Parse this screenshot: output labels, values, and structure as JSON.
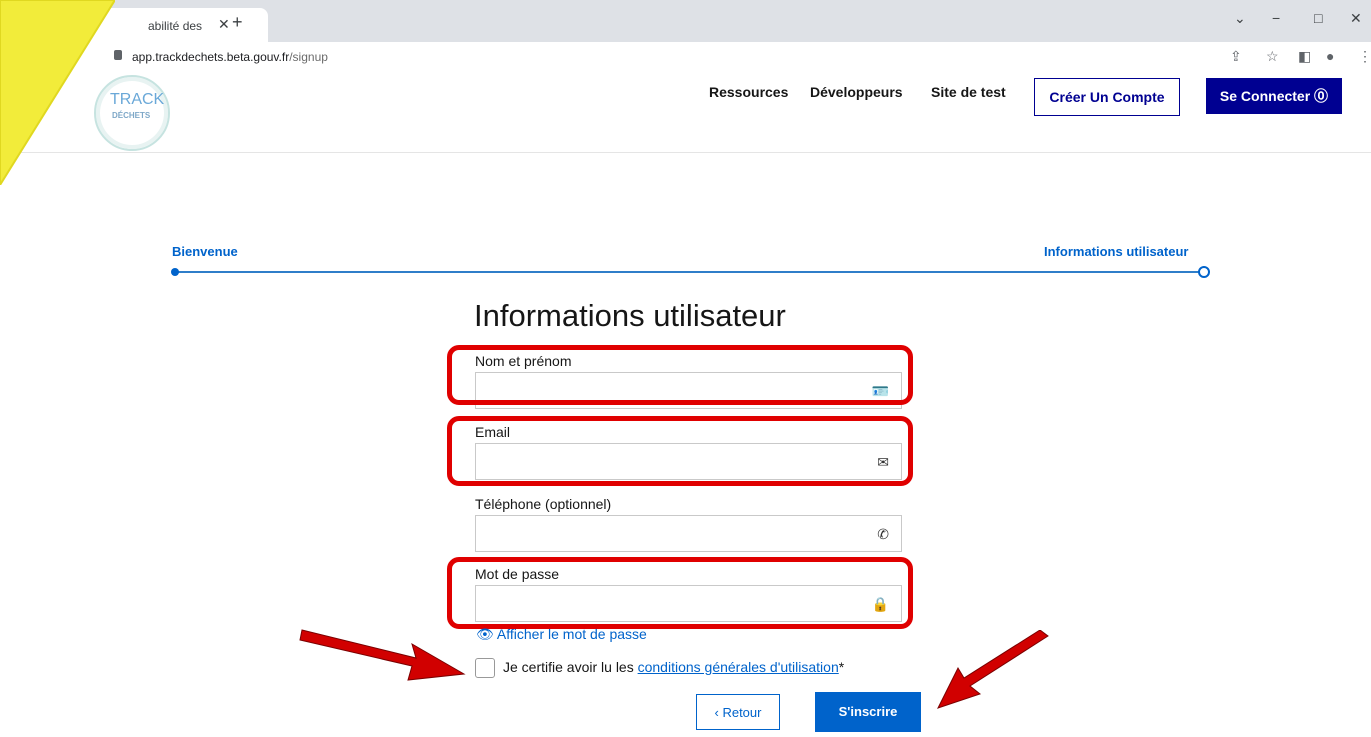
{
  "browser": {
    "tab_title": "abilité des",
    "tab_close": "✕",
    "new_tab": "+",
    "url_host": "app.trackdechets.beta.gouv.fr",
    "url_path": "/signup"
  },
  "site": {
    "logo_line1": "TRACK",
    "logo_line2": "DÉCHETS",
    "nav": [
      "Ressources",
      "Développeurs",
      "Site de test"
    ],
    "create_account": "Créer Un Compte",
    "login": "Se Connecter ⓪"
  },
  "stepper": {
    "step1": "Bienvenue",
    "step2": "Informations utilisateur"
  },
  "form": {
    "title": "Informations utilisateur",
    "fields": [
      {
        "label": "Nom et prénom",
        "icon": "id-card-icon"
      },
      {
        "label": "Email",
        "icon": "mail-icon"
      },
      {
        "label": "Téléphone (optionnel)",
        "icon": "phone-icon"
      },
      {
        "label": "Mot de passe",
        "icon": "lock-icon"
      }
    ],
    "show_password": "Afficher le mot de passe",
    "cgu_prefix": "Je certifie avoir lu les ",
    "cgu_link": "conditions générales d'utilisation",
    "cgu_suffix": "*",
    "back": "‹  Retour",
    "submit": "S'inscrire"
  },
  "colors": {
    "primary": "#000091",
    "link": "#0063cb",
    "highlight": "#e00000",
    "sticky": "#f2ec3a"
  }
}
